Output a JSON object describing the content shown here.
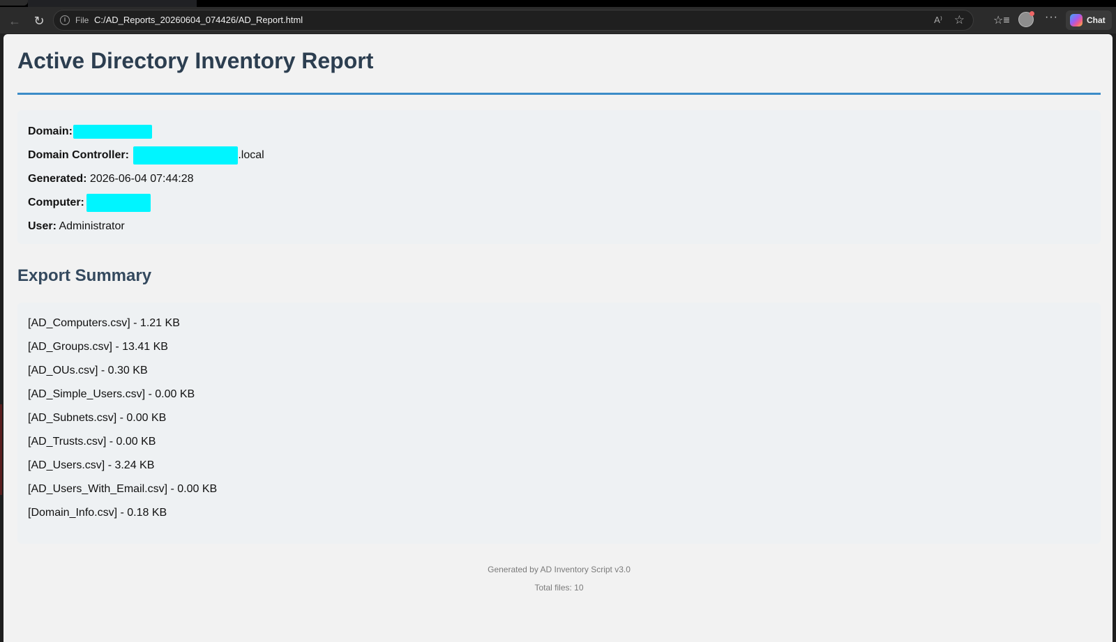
{
  "browser": {
    "scheme": "File",
    "url": "C:/AD_Reports_20260604_074426/AD_Report.html",
    "read_aloud": "A⁾",
    "chat_label": "Chat"
  },
  "report": {
    "title": "Active Directory Inventory Report",
    "info": {
      "domain_label": "Domain:",
      "dc_label": "Domain Controller:",
      "dc_suffix": ".local",
      "generated_label": "Generated:",
      "generated_value": "2026-06-04 07:44:28",
      "computer_label": "Computer:",
      "user_label": "User:",
      "user_value": "Administrator"
    },
    "summary_heading": "Export Summary",
    "files": [
      "[AD_Computers.csv] - 1.21 KB",
      "[AD_Groups.csv] - 13.41 KB",
      "[AD_OUs.csv] - 0.30 KB",
      "[AD_Simple_Users.csv] - 0.00 KB",
      "[AD_Subnets.csv] - 0.00 KB",
      "[AD_Trusts.csv] - 0.00 KB",
      "[AD_Users.csv] - 3.24 KB",
      "[AD_Users_With_Email.csv] - 0.00 KB",
      "[Domain_Info.csv] - 0.18 KB"
    ],
    "footer": {
      "generated_by": "Generated by AD Inventory Script v3.0",
      "total_files": "Total files: 10"
    }
  },
  "colors": {
    "heading": "#2c3e50",
    "rule": "#3c8cc8",
    "redaction": "#00f5ff",
    "page_bg": "#f2f2f2",
    "box_bg": "#eef1f3"
  }
}
